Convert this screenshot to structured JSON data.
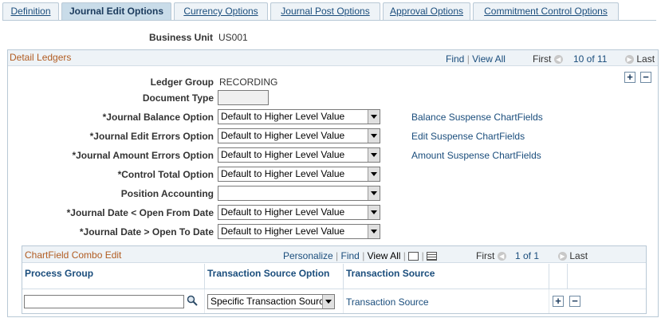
{
  "tabs": [
    {
      "label": "Definition",
      "active": false
    },
    {
      "label": "Journal Edit Options",
      "active": true
    },
    {
      "label": "Currency Options",
      "active": false
    },
    {
      "label": "Journal Post Options",
      "active": false
    },
    {
      "label": "Approval Options",
      "active": false
    },
    {
      "label": "Commitment Control Options",
      "active": false
    }
  ],
  "business_unit": {
    "label": "Business Unit",
    "value": "US001"
  },
  "detail_ledgers": {
    "title": "Detail Ledgers",
    "find": "Find",
    "view_all": "View All",
    "first": "First",
    "count": "10 of 11",
    "last": "Last",
    "fields": [
      {
        "label": "Ledger Group",
        "value": "RECORDING"
      },
      {
        "label": "Document Type",
        "value": ""
      },
      {
        "label": "*Journal Balance Option",
        "value": "Default to Higher Level Value"
      },
      {
        "label": "*Journal Edit Errors Option",
        "value": "Default to Higher Level Value"
      },
      {
        "label": "*Journal Amount Errors Option",
        "value": "Default to Higher Level Value"
      },
      {
        "label": "*Control Total Option",
        "value": "Default to Higher Level Value"
      },
      {
        "label": "Position Accounting",
        "value": ""
      },
      {
        "label": "*Journal Date < Open From Date",
        "value": "Default to Higher Level Value"
      },
      {
        "label": "*Journal Date > Open To Date",
        "value": "Default to Higher Level Value"
      }
    ],
    "links": [
      "Balance Suspense ChartFields",
      "Edit Suspense ChartFields",
      "Amount Suspense ChartFields"
    ]
  },
  "combo_edit": {
    "title": "ChartField Combo Edit",
    "personalize": "Personalize",
    "find": "Find",
    "view_all": "View All",
    "first": "First",
    "count": "1 of 1",
    "last": "Last",
    "columns": [
      "Process Group",
      "Transaction Source Option",
      "Transaction Source"
    ],
    "row": {
      "process_group": "",
      "option": "Specific Transaction Source",
      "source": "Transaction Source"
    }
  },
  "colors": {
    "accent": "#1a4d7c",
    "section_title": "#b15c22",
    "border": "#b9c9d6",
    "header_bg": "#eef3f7"
  }
}
